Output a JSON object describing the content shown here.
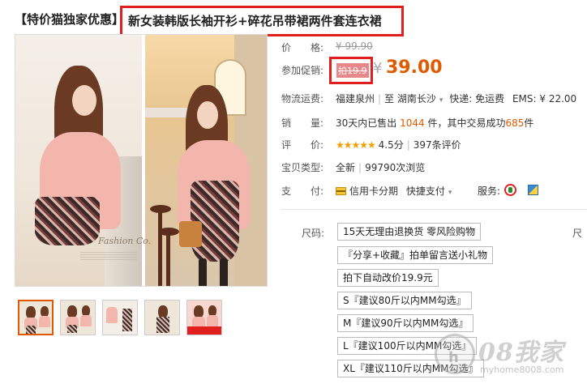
{
  "title": {
    "prefix": "【特价猫独家优惠】",
    "name": "新女装韩版长袖开衫+碎花吊带裙两件套连衣裙"
  },
  "gallery": {
    "brand_script": "Fashion Co.",
    "thumbnail_count": 5
  },
  "price": {
    "label": "价　　格:",
    "original": "¥ 99.90"
  },
  "promo": {
    "label": "参加促销:",
    "tag": "拍19.9",
    "yen": "¥",
    "value": "39.00"
  },
  "shipping": {
    "label": "物流运费:",
    "from": "福建泉州",
    "sep": "|",
    "to_prefix": "至",
    "to": "湖南长沙",
    "express": "快递: 免运费",
    "ems": "EMS: ¥ 22.00"
  },
  "sales": {
    "label": "销　　量:",
    "prefix": "30天内已售出",
    "sold": "1044",
    "middle": "件，其中交易成功",
    "success": "685",
    "suffix": "件"
  },
  "rating": {
    "label": "评　　价:",
    "stars": "★★★★★",
    "score": "4.5分",
    "sep": "|",
    "reviews": "397条评价"
  },
  "item_type": {
    "label": "宝贝类型:",
    "value": "全新",
    "sep": "|",
    "views": "99790次浏览"
  },
  "payment": {
    "label": "支　　付:",
    "credit": "信用卡分期",
    "quick": "快捷支付",
    "service_label": "服务:"
  },
  "size": {
    "label": "尺码:",
    "edge_label": "尺",
    "options": [
      "15天无理由退换货 零风险购物",
      "『分享+收藏』拍单留言送小礼物",
      "拍下自动改价19.9元",
      "S『建议80斤以内MM勾选』",
      "M『建议90斤以内MM勾选』",
      "L『建议100斤以内MM勾选』",
      "XL『建议110斤以内MM勾选』"
    ]
  },
  "watermark": {
    "badge": "h",
    "text": "08我家",
    "url": "myhome8008.com"
  },
  "colors": {
    "accent_orange": "#e05a00",
    "highlight_red": "#e0201f",
    "promo_pink": "#e6888a",
    "star_gold": "#f0a000"
  }
}
